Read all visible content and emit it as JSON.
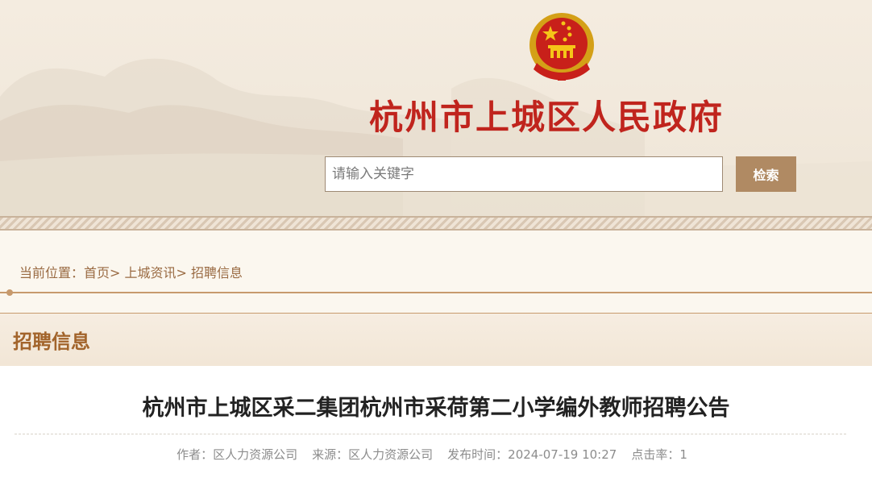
{
  "header": {
    "site_title": "杭州市上城区人民政府",
    "emblem": "national-emblem"
  },
  "search": {
    "placeholder": "请输入关键字",
    "value": "",
    "button_label": "检索"
  },
  "breadcrumb": {
    "prefix": "当前位置：",
    "items": [
      "首页",
      "上城资讯",
      "招聘信息"
    ],
    "separator": ">"
  },
  "section": {
    "title": "招聘信息"
  },
  "article": {
    "title": "杭州市上城区采二集团杭州市采荷第二小学编外教师招聘公告",
    "meta": {
      "author": "作者：区人力资源公司",
      "source": "来源：区人力资源公司",
      "published": "发布时间：2024-07-19 10:27",
      "hits": "点击率：1"
    }
  },
  "colors": {
    "title_red": "#c0241d",
    "accent_brown": "#b08a63",
    "breadcrumb": "#9a6b43",
    "section_title": "#a2642b"
  }
}
